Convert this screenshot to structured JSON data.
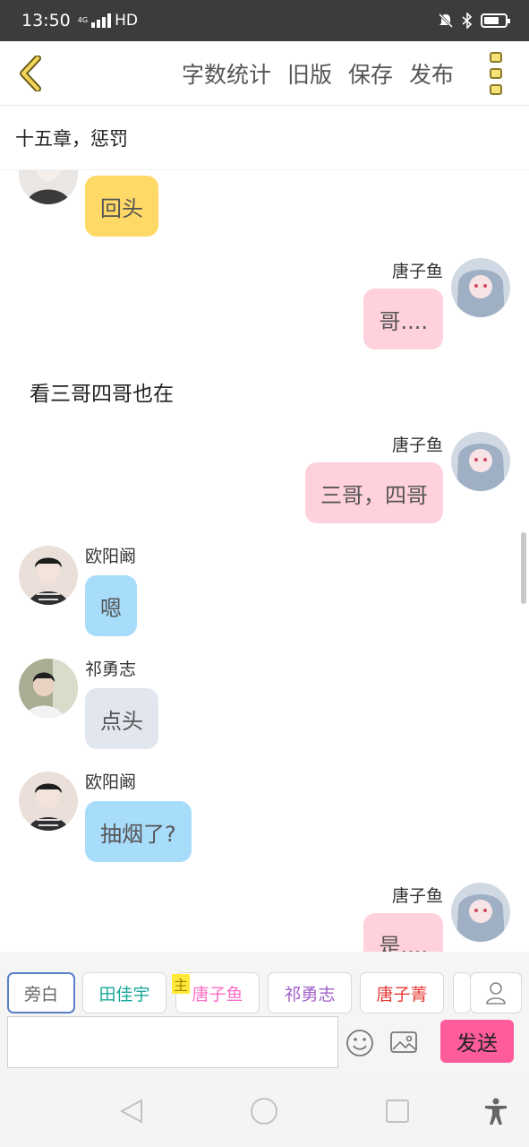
{
  "status_bar": {
    "time": "13:50",
    "network": "4G",
    "hd": "HD"
  },
  "toolbar": {
    "actions": [
      "字数统计",
      "旧版",
      "保存",
      "发布"
    ]
  },
  "chapter": {
    "title": "十五章，惩罚"
  },
  "messages": [
    {
      "type": "bubble",
      "side": "left",
      "speaker": "",
      "text": "回头",
      "color": "#ffd966"
    },
    {
      "type": "bubble",
      "side": "right",
      "speaker": "唐子鱼",
      "text": "哥....",
      "color": "#ffd1dc"
    },
    {
      "type": "narration",
      "text": "看三哥四哥也在"
    },
    {
      "type": "bubble",
      "side": "right",
      "speaker": "唐子鱼",
      "text": "三哥，四哥",
      "color": "#ffd1dc"
    },
    {
      "type": "bubble",
      "side": "left",
      "speaker": "欧阳阚",
      "text": "嗯",
      "color": "#a8dcfb"
    },
    {
      "type": "bubble",
      "side": "left",
      "speaker": "祁勇志",
      "text": "点头",
      "color": "#e1e6ef"
    },
    {
      "type": "bubble",
      "side": "left",
      "speaker": "欧阳阚",
      "text": "抽烟了?",
      "color": "#a8dcfb"
    },
    {
      "type": "bubble",
      "side": "right",
      "speaker": "唐子鱼",
      "text": "是....",
      "color": "#ffd1dc"
    }
  ],
  "characters": {
    "narration": "旁白",
    "list": [
      {
        "name": "田佳宇",
        "color": "#1aa89a"
      },
      {
        "name": "唐子鱼",
        "color": "#ff6ec7",
        "badge": "主"
      },
      {
        "name": "祁勇志",
        "color": "#a05ec8"
      },
      {
        "name": "唐子菁",
        "color": "#e53935"
      }
    ]
  },
  "input": {
    "value": "",
    "placeholder": "",
    "send_label": "发送"
  },
  "colors": {
    "accent": "#ff5c9c",
    "narration_border": "#5a7fc7"
  }
}
